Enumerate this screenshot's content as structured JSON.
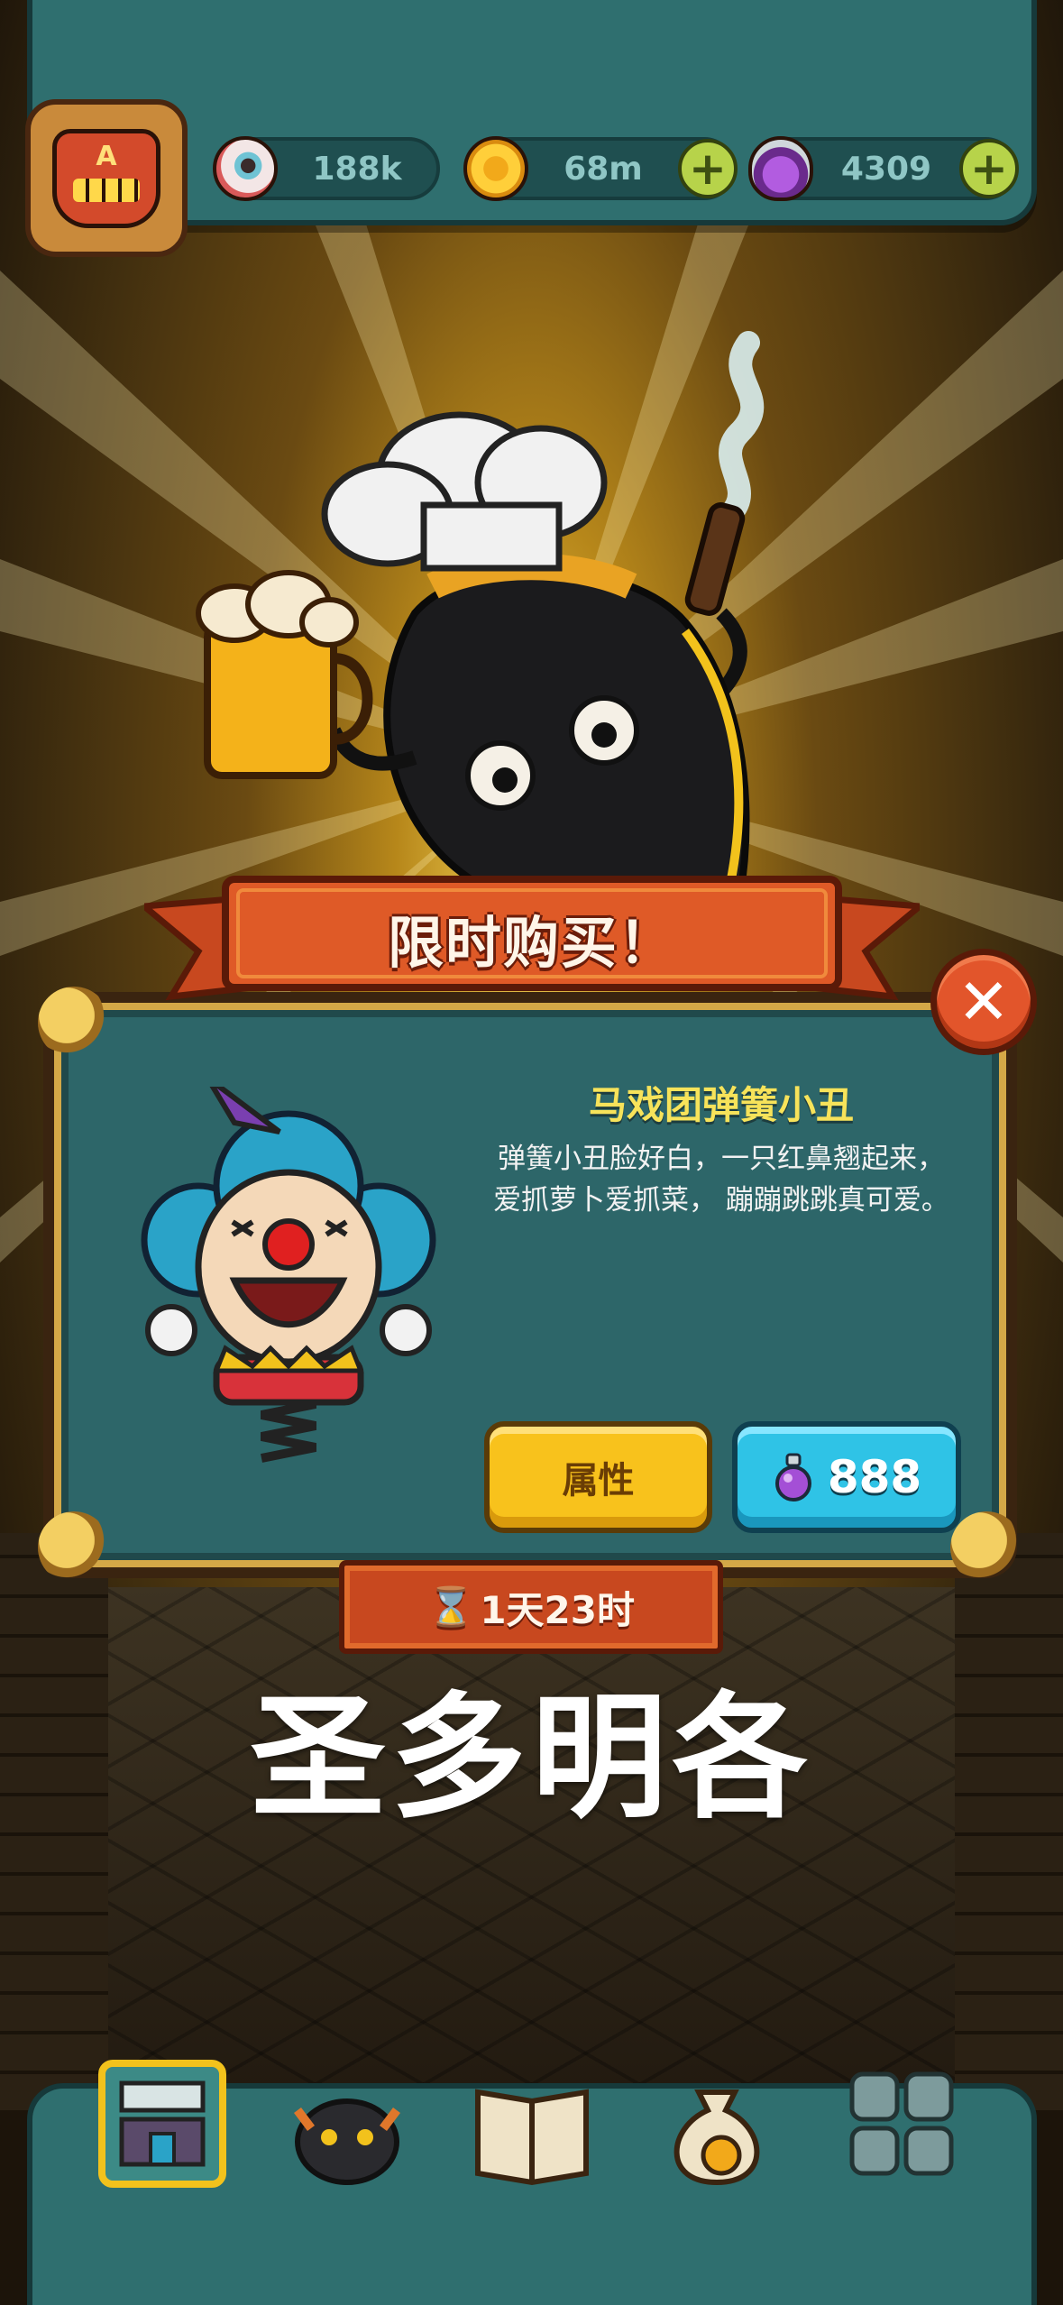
{
  "resources": {
    "eyeballs": "188k",
    "coins": "68m",
    "potions": "4309"
  },
  "avatar": {
    "letter": "A"
  },
  "offer": {
    "banner_title": "限时购买！",
    "item_name": "马戏团弹簧小丑",
    "description_line1": "弹簧小丑脸好白，一只红鼻翘起来，",
    "description_line2": "爱抓萝卜爱抓菜， 蹦蹦跳跳真可爱。",
    "attributes_label": "属性",
    "price": "888",
    "timer": "1天23时"
  },
  "overlay_text": "圣多明各",
  "colors": {
    "panel_teal": "#2d6669",
    "banner_red": "#c8481f",
    "title_yellow": "#f7e35a",
    "attr_button": "#f8c21c",
    "buy_button": "#2fc3e6"
  },
  "icons": {
    "eyeball": "eyeball-icon",
    "coin": "coin-icon",
    "potion": "potion-icon",
    "close": "close-icon",
    "hourglass": "hourglass-icon"
  }
}
